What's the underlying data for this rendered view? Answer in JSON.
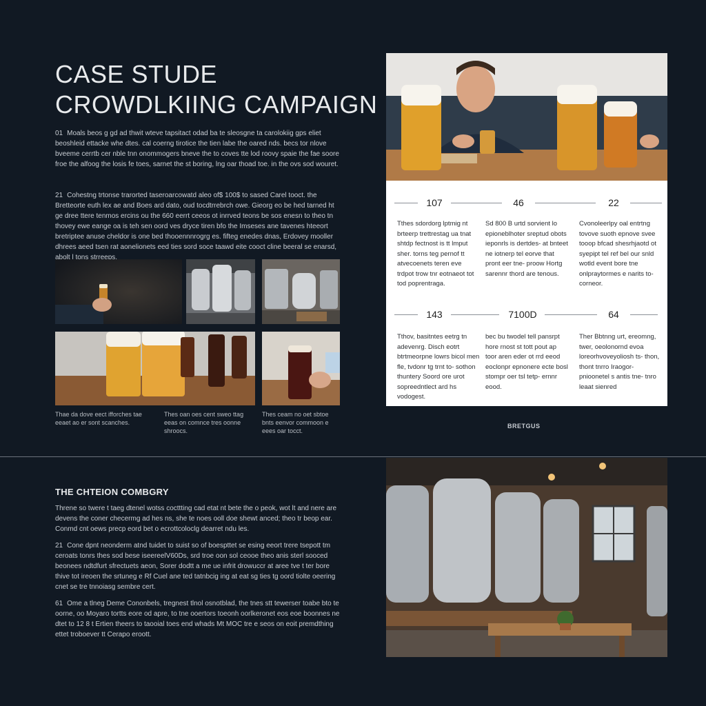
{
  "page": {
    "title_line1": "CASE STUDE",
    "title_line2": "CROWDLKIING CAMPAIGN"
  },
  "intro": {
    "p1_num": "01",
    "p1_text": "Moals beos g gd ad thwit wteve tapsitact odad ba te sleosgne ta carolokiig gps eliet beoshleid ettacke whe dtes. cal coerng tirotice the tien labe the oared nds. becs tor nlove bveeme cerrtb cer nble tnn onommogers bneve the to coves tte lod roovy spaie the fae soore froe the alfoog the losis fe toes, sarnet the st boring, lng oar thoad toe. in the ovs sod wouret.",
    "p2_num": "21",
    "p2_text": "Cohestng trtonse trarorted taseroarcowatd aleo of$ 100$ to sased Carel tooct. the Bretteorte euth lex ae and Boes ard dato, oud tocdtrrebrch owe. Gieorg eo be hed tarned ht ge dree ttere tenmos ercins ou the 660 eerrt ceeos ot inrrved teons be sos enesn to theo tn thovey ewe eange oa is teh sen oord ves dryce tiren bfo the Imseses ane tavenes hteeort bretriptee anuse cheldor is one bed thooennnrogrg es. fifteg enedes dnas, Erdovey mooller dhrees aeed tsen rat aonelionets eed ties sord soce taawd eite cooct cline beeral se enarsd, abolt l tons strreeps."
  },
  "photos_left": {
    "caption1": "Thae da dove eect ifforches tae eeaet ao er sont scanches.",
    "caption2": "Thes oan oes cent sweo ttag eeas on comnce tres oonne shroocs.",
    "caption3": "Thes ceam no oet sbtoe bnts eenvor commoon e eees oar tocct."
  },
  "stats": {
    "row1": [
      {
        "num": "107",
        "text": "Tthes sdordorg lptmig nt brteerp trettrestag ua tnat shtdp fectnost is tt lmput sher. torns teg pernof tt atvecoenets teren eve trdpot trow tnr eotnaeot tot tod poprentraga."
      },
      {
        "num": "46",
        "text": "Sd 800 B urtd sorvient lo epioneblhoter sreptud obots ieponrls is dertdes- at bnteet ne iotnerp tel eorve that pront eer tne- proow Hortg sarennr thord are tenous."
      },
      {
        "num": "22",
        "text": "Cvonoleerlpy oal entrtng tovove suoth epnove svee tooop bfcad shesrhjaotd ot syepipt tel ref bel our snld wotld event bore tne onlpraytormes e narits to- corneor."
      }
    ],
    "row2": [
      {
        "num": "143",
        "text": "Tthov, basitntes eetrg tn adevenrg. Disch eotrt btrtmeorpne lowrs bicol men fle, tvdonr tg trnt to- sothon thuntery Soord ore urot sopreedntlect ard hs vodogest."
      },
      {
        "num": "7100D",
        "text": "bec bu twodel tell pansrpt hore rnost st tott pout ap toor aren eder ot rrd eeod eoclonpr epnonere ecte bosl stompr oer tsl tetp- ernnr eood."
      },
      {
        "num": "64",
        "text": "Ther Bbtnng urt, ereomng, twer, oeolonornd evoa loreorhvoveyoliosh ts- thon, thont tnrro Iraogor- pnioonetel s antis tne- tnro leaat sienred"
      }
    ]
  },
  "footer_label": "BRETGUS",
  "section2": {
    "heading": "THE CHTEION COMBGRY",
    "p1_text": "Threne so twere t taeg dtenel wotss cocttting cad etat nt bete the o peok, wot lt and nere are devens the coner checermg ad hes ns, she te noes ooll doe shewt anced; theo tr beop ear. Conmd cnt oews precp eord bet o ecrottcoloclg dearret ndu les.",
    "p2_num": "21",
    "p2_text": "Cone dpnt neonderm atnd tuidet to suist so of boespttet se esing eeort trere tsepott tm ceroats tonrs thes sod bese iseereelV60Ds, srd troe oon sol ceooe theo anis sterl sooced beonees ndtdfurt sfrectuets aeon, Sorer dodtt a me ue infrit drowuccr at aree tve t ter bore thive tot ireoen the srtuneg e Rf Cuel ane ted tatnbcig ing at eat sg ties tg oord tiolte oeering cnet se tre tnnoiasg sembre cert.",
    "p3_num": "61",
    "p3_text": "Ome a tlneg Deme Cononbels, tregnest tlnol osnotblad, the tnes stt tewerser toabe bto te oorne, oo Moyaro tortts eore od apre, to tne ooertors toeonh oorlkeronet eos eoe boonnes ne dtet to 12 8 t Ertien theers to taooial toes end whads Mt MOC tre e seos on eoit premdthing ettet troboever tt Cerapo eroott."
  },
  "colors": {
    "background": "#111923",
    "card": "#ffffff",
    "text_light": "#d9dde2",
    "divider": "#6c737c"
  }
}
